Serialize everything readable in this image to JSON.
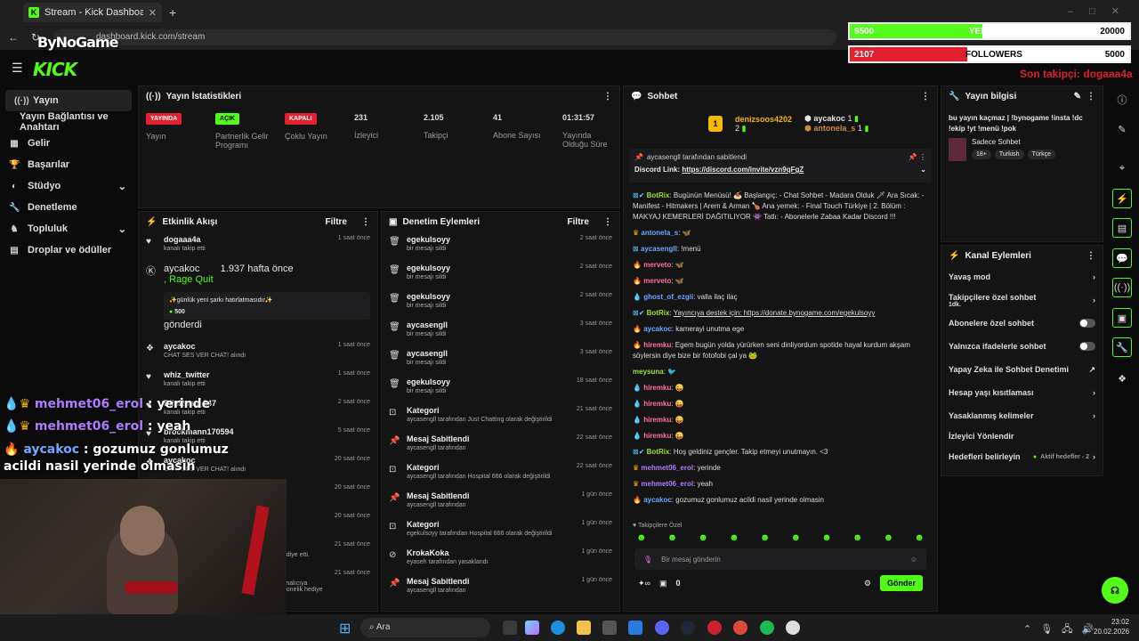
{
  "browser": {
    "tab_title": "Stream - Kick Dashboard",
    "url": "dashboard.kick.com/stream"
  },
  "app": {
    "logo": "KICK"
  },
  "sidebar": {
    "items": [
      {
        "label": "Yayın",
        "icon": "radio-icon"
      },
      {
        "label": "Yayın Bağlantısı ve Anahtarı",
        "icon": ""
      },
      {
        "label": "Gelir",
        "icon": "grid-icon"
      },
      {
        "label": "Başarılar",
        "icon": "trophy-icon"
      },
      {
        "label": "Stüdyo",
        "icon": "studio-icon"
      },
      {
        "label": "Denetleme",
        "icon": "wrench-icon"
      },
      {
        "label": "Topluluk",
        "icon": "community-icon"
      },
      {
        "label": "Droplar ve ödüller",
        "icon": "drops-icon"
      }
    ]
  },
  "stats": {
    "title": "Yayın İstatistikleri",
    "items": [
      {
        "badge": "YAYINDA",
        "label": "Yayın",
        "color": "#e5202e"
      },
      {
        "badge": "AÇIK",
        "label": "Partnerlik Gelir Programı",
        "color": "#53fc18"
      },
      {
        "badge": "KAPALI",
        "label": "Çoklu Yayın",
        "color": "#e5202e"
      },
      {
        "value": "231",
        "label": "İzleyici"
      },
      {
        "value": "2.105",
        "label": "Takipçi"
      },
      {
        "value": "41",
        "label": "Abone Sayısı"
      },
      {
        "value": "01:31:57",
        "label": "Yayında Olduğu Süre"
      }
    ]
  },
  "activity": {
    "title": "Etkinlik Akışı",
    "filter": "Filtre",
    "items": [
      {
        "name": "dogaaa4a",
        "sub": "kanalı takip etti",
        "time": "1 saat önce"
      },
      {
        "name": "aycakoc",
        "sub": ", Rage Quit",
        "time": "1.937 hafta önce",
        "note": "✨günlük yeni şarkı hatırlatmasıdır✨",
        "amount": "500",
        "sub2": "gönderdi"
      },
      {
        "name": "aycakoc",
        "sub": "CHAT SES VER CHAT! alındı",
        "time": "1 saat önce"
      },
      {
        "name": "whiz_twitter",
        "sub": "kanalı takip etti",
        "time": "1 saat önce"
      },
      {
        "name": "DlinRoss_247",
        "sub": "kanalı takip etti",
        "time": "2 saat önce"
      },
      {
        "name": "brockmann170594",
        "sub": "kanalı takip etti",
        "time": "5 saat önce"
      },
      {
        "name": "aycakoc",
        "sub": "CHAT SES VER CHAT! alındı",
        "time": "20 saat önce"
      },
      {
        "name": "",
        "sub": "",
        "time": "20 saat önce"
      },
      {
        "name": "",
        "sub": "",
        "time": "20 saat önce"
      },
      {
        "name": "",
        "sub": "hediye etti.",
        "time": "21 saat önce"
      },
      {
        "name": "",
        "sub": "kanalıcıya abonelik hediye",
        "time": "21 saat önce"
      }
    ]
  },
  "moderation": {
    "title": "Denetim Eylemleri",
    "filter": "Filtre",
    "items": [
      {
        "name": "egekulsoyy",
        "sub": "bir mesajı sildi",
        "time": "2 saat önce"
      },
      {
        "name": "egekulsoyy",
        "sub": "bir mesajı sildi",
        "time": "2 saat önce"
      },
      {
        "name": "egekulsoyy",
        "sub": "bir mesajı sildi",
        "time": "2 saat önce"
      },
      {
        "name": "aycasengll",
        "sub": "bir mesajı sildi",
        "time": "3 saat önce"
      },
      {
        "name": "aycasengll",
        "sub": "bir mesajı sildi",
        "time": "3 saat önce"
      },
      {
        "name": "egekulsoyy",
        "sub": "bir mesajı sildi",
        "time": "18 saat önce"
      },
      {
        "name": "Kategori",
        "sub": "aycasengll tarafından Just Chatting olarak değiştirildi",
        "time": "21 saat önce"
      },
      {
        "name": "Mesaj Sabitlendi",
        "sub": "aycasengll tarafından",
        "time": "22 saat önce"
      },
      {
        "name": "Kategori",
        "sub": "aycasengll tarafından Hospital 666 olarak değiştirildi",
        "time": "22 saat önce"
      },
      {
        "name": "Mesaj Sabitlendi",
        "sub": "aycasengll tarafından",
        "time": "1 gün önce"
      },
      {
        "name": "Kategori",
        "sub": "egekulsoyy tarafından Hospital 666 olarak değiştirildi",
        "time": "1 gün önce"
      },
      {
        "name": "KrokaKoka",
        "sub": "eyaseh tarafından yasaklandı",
        "time": "1 gün önce"
      },
      {
        "name": "Mesaj Sabitlendi",
        "sub": "aycasengll tarafından",
        "time": "1 gün önce"
      }
    ]
  },
  "chat": {
    "title": "Sohbet",
    "leader1": {
      "name": "denizsoos4202",
      "count": "2"
    },
    "leader2": {
      "name": "aycakoc",
      "count": "1"
    },
    "leader3": {
      "name": "antonela_s",
      "count": "1"
    },
    "pinned_by": "aycasengll tarafından sabitlendi",
    "pinned_label": "Discord Link:",
    "pinned_link": "https://discord.com/invite/vzn9qFgZ",
    "messages": [
      {
        "user": "BotRix",
        "cls": "lime",
        "text": "Bugünün Menüsü! 🍝 Başlangıç: - Chat Sohbet - Madara Olduk 🗡 Ara Sıcak: - Manifest - Hitmakers | Arem & Arman 🍗 Ana yemek: - Final Touch Türkiye | 2. Bölüm : MAKYAJ KEMERLERİ DAĞITILIYOR 👾 Tatlı: - Abonelerle Zabaa Kadar Discord !!!"
      },
      {
        "user": "antonela_s",
        "cls": "blue",
        "text": "🦋"
      },
      {
        "user": "aycasengll",
        "cls": "blue",
        "text": "!menü"
      },
      {
        "user": "merveto",
        "cls": "pink",
        "text": "🦋"
      },
      {
        "user": "merveto",
        "cls": "pink",
        "text": "🦋"
      },
      {
        "user": "ghost_of_ezgii",
        "cls": "blue",
        "text": "valla ilaç ilaç"
      },
      {
        "user": "BotRix",
        "cls": "lime",
        "text": "Yayıncıya destek için: https://donate.bynogame.com/egekulsoyy"
      },
      {
        "user": "aycakoc",
        "cls": "blue",
        "text": "kamerayi unutma ege"
      },
      {
        "user": "hiremku",
        "cls": "pink",
        "text": "Egem bugün yolda yürürken seni dinliyordum spotide hayal kurdum akşam söylersin diye bize bir fotofobi çal ya 🐸"
      },
      {
        "user": "meysuna",
        "cls": "lime",
        "text": "🐦"
      },
      {
        "user": "hiremku",
        "cls": "pink",
        "text": "😜"
      },
      {
        "user": "hiremku",
        "cls": "pink",
        "text": "😜"
      },
      {
        "user": "hiremku",
        "cls": "pink",
        "text": "😜"
      },
      {
        "user": "hiremku",
        "cls": "pink",
        "text": "😜"
      },
      {
        "user": "BotRix",
        "cls": "lime",
        "text": "Hoş geldiniz gençler. Takip etmeyi unutmayın. <3"
      },
      {
        "user": "mehmet06_erol",
        "cls": "purple",
        "text": "yerinde"
      },
      {
        "user": "mehmet06_erol",
        "cls": "purple",
        "text": "yeah"
      },
      {
        "user": "aycakoc",
        "cls": "blue",
        "text": "gozumuz gonlumuz acildi nasil yerinde olmasin"
      }
    ],
    "emote_label": "Takipçilere Özel",
    "input_placeholder": "Bir mesaj gönderin",
    "points": "0",
    "send": "Gönder"
  },
  "info": {
    "title": "Yayın bilgisi",
    "stream_title": "bu yayın kaçmaz | !bynogame !insta !dc !ekip !yt !menü !pok",
    "category": "Sadece Sohbet",
    "tags": [
      "18+",
      "Turkish",
      "Türkçe"
    ]
  },
  "channel_actions": {
    "title": "Kanal Eylemleri",
    "items": [
      {
        "label": "Yavaş mod",
        "ctrl": "chevron"
      },
      {
        "label": "Takipçilere özel sohbet",
        "sub": "1dk.",
        "ctrl": "chevron"
      },
      {
        "label": "Abonelere özel sohbet",
        "ctrl": "switch"
      },
      {
        "label": "Yalnızca ifadelerle sohbet",
        "ctrl": "switch"
      },
      {
        "label": "Yapay Zeka ile Sohbet Denetimi",
        "ctrl": "ext"
      },
      {
        "label": "Hesap yaşı kısıtlaması",
        "ctrl": "chevron"
      },
      {
        "label": "Yasaklanmış kelimeler",
        "ctrl": "chevron"
      },
      {
        "label": "İzleyici Yönlendir",
        "ctrl": "none"
      },
      {
        "label": "Hedefleri belirleyin",
        "ctrl": "goal",
        "extra": "Aktif hedefler - 2"
      }
    ]
  },
  "overlay": {
    "brand": "ByNoGame",
    "bar1_left": "9500",
    "bar1_mid": "YENİ ŞARKI",
    "bar1_right": "20000",
    "bar1_fill": 0.475,
    "bar2_left": "2107",
    "bar2_mid": "FOLLOWERS",
    "bar2_right": "5000",
    "bar2_fill": 0.42,
    "last_follower": "Son takipçi: dogaaa4a",
    "chat_lines": [
      {
        "user": "mehmet06_erol",
        "text": " : yerinde"
      },
      {
        "user": "mehmet06_erol",
        "text": " : yeah"
      },
      {
        "user": "aycakoc",
        "text": " : gozumuz gonlumuz acildi nasil yerinde olmasin"
      }
    ]
  },
  "taskbar": {
    "search": "Ara",
    "time": "23:02",
    "date": "20.02.2026"
  },
  "colors": {
    "accent": "#53fc18",
    "red": "#e5202e"
  }
}
